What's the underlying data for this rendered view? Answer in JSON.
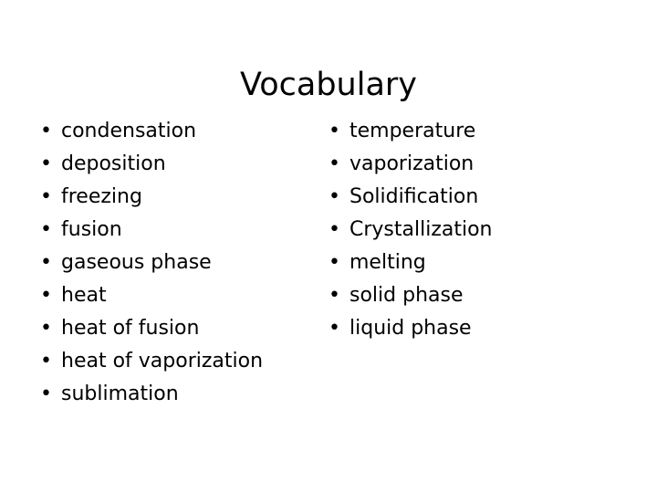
{
  "slide": {
    "title": "Vocabulary",
    "background_color": "#ffffff",
    "text_color": "#000000",
    "bullet_glyph": "•"
  },
  "columns": {
    "left": {
      "items": [
        "condensation",
        "deposition",
        "freezing",
        "fusion",
        "gaseous phase",
        "heat",
        "heat of fusion",
        "heat of vaporization",
        "sublimation"
      ]
    },
    "right": {
      "items": [
        "temperature",
        "vaporization",
        "Solidification",
        "Crystallization",
        "melting",
        "solid phase",
        "liquid phase"
      ]
    }
  }
}
